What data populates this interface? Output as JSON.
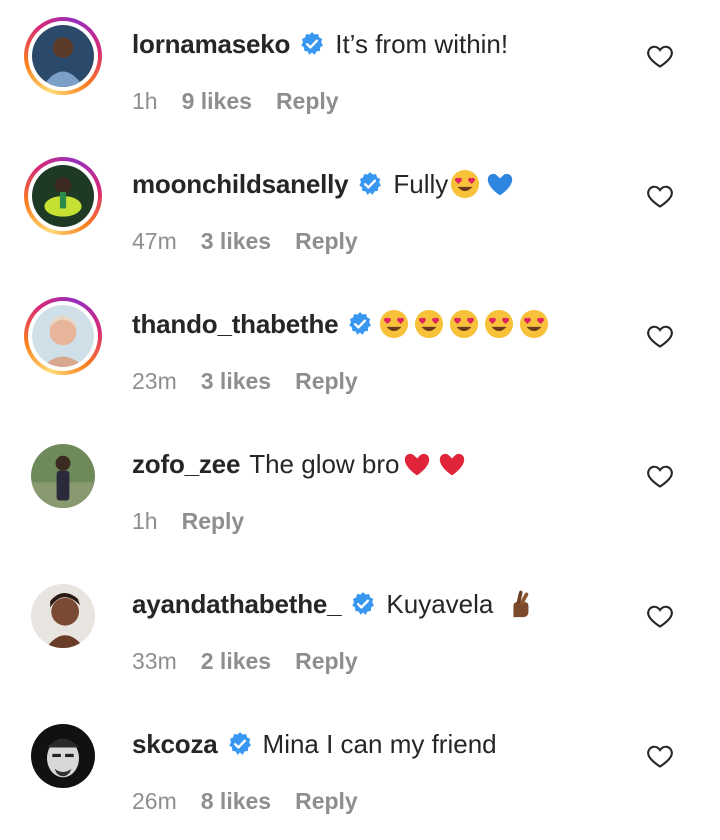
{
  "comments": [
    {
      "username": "lornamaseko",
      "verified": true,
      "text": "It’s from within!",
      "time": "1h",
      "likes": "9 likes",
      "reply": "Reply",
      "story": true,
      "avatar_color": "#5a7fa6",
      "emoji": []
    },
    {
      "username": "moonchildsanelly",
      "verified": true,
      "text": "Fully",
      "time": "47m",
      "likes": "3 likes",
      "reply": "Reply",
      "story": true,
      "avatar_color": "#3a7a3a",
      "emoji": [
        "heart-eyes-emoji",
        "blue-heart-emoji"
      ]
    },
    {
      "username": "thando_thabethe",
      "verified": true,
      "text": "",
      "time": "23m",
      "likes": "3 likes",
      "reply": "Reply",
      "story": true,
      "avatar_color": "#e8cfc2",
      "emoji": [
        "heart-eyes-emoji",
        "heart-eyes-emoji",
        "heart-eyes-emoji",
        "heart-eyes-emoji",
        "heart-eyes-emoji"
      ]
    },
    {
      "username": "zofo_zee",
      "verified": false,
      "text": "The glow bro",
      "time": "1h",
      "likes": "",
      "reply": "Reply",
      "story": false,
      "avatar_color": "#6b5a4a",
      "emoji": [
        "red-heart-emoji",
        "red-heart-emoji"
      ]
    },
    {
      "username": "ayandathabethe_",
      "verified": true,
      "text": "Kuyavela",
      "time": "33m",
      "likes": "2 likes",
      "reply": "Reply",
      "story": false,
      "avatar_color": "#c9a58c",
      "emoji": [
        "crossed-fingers-emoji"
      ]
    },
    {
      "username": "skcoza",
      "verified": true,
      "text": "Mina I can my friend",
      "time": "26m",
      "likes": "8 likes",
      "reply": "Reply",
      "story": false,
      "avatar_color": "#1a1a1a",
      "emoji": []
    }
  ]
}
